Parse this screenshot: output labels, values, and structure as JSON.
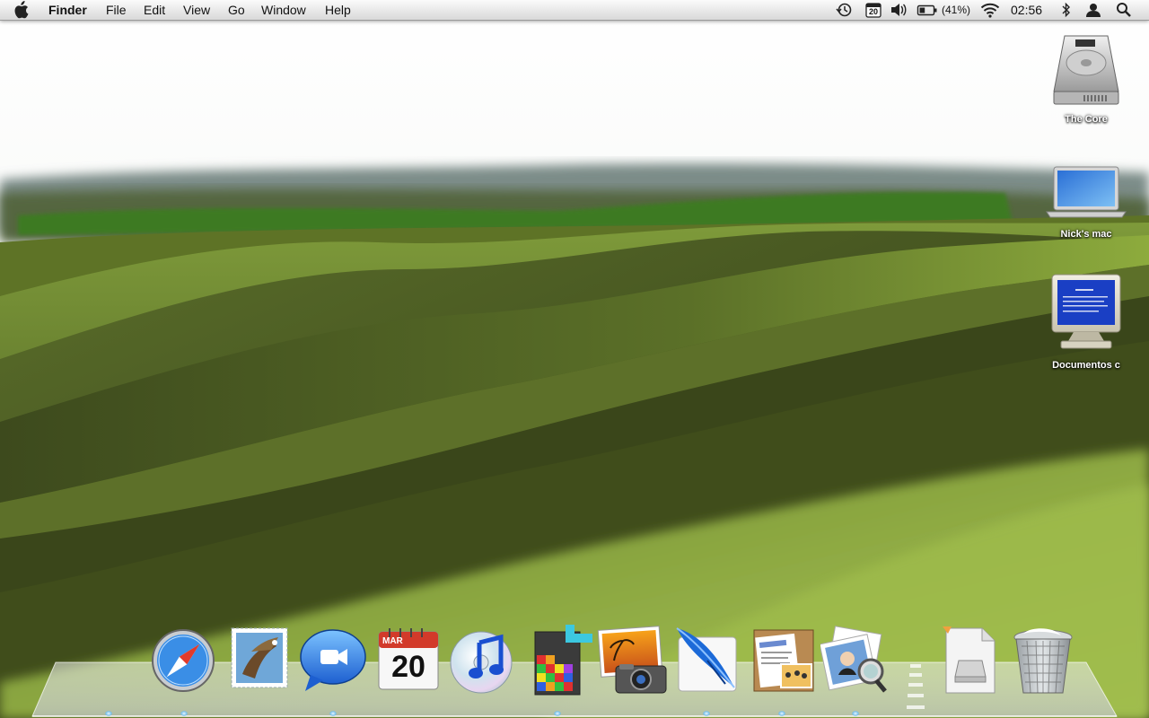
{
  "menubar": {
    "app_name": "Finder",
    "menus": [
      "File",
      "Edit",
      "View",
      "Go",
      "Window",
      "Help"
    ],
    "tray": {
      "calendar_day": "20",
      "battery_percent": "(41%)",
      "time": "02:56",
      "icons": [
        "time-machine-icon",
        "ical-icon",
        "volume-icon",
        "battery-icon",
        "wifi-icon",
        "bluetooth-icon",
        "user-icon",
        "spotlight-icon"
      ]
    }
  },
  "desktop": {
    "icons": [
      {
        "label": "The Core",
        "icon": "hard-drive-icon"
      },
      {
        "label": "Nick's mac",
        "icon": "macbook-icon"
      },
      {
        "label": "Documentos c",
        "icon": "pc-monitor-icon"
      }
    ]
  },
  "dock": {
    "apps": [
      {
        "name": "safari",
        "running": true
      },
      {
        "name": "mail",
        "running": true
      },
      {
        "name": "ichat",
        "running": false
      },
      {
        "name": "ical",
        "running": true,
        "month": "MAR",
        "day": "20"
      },
      {
        "name": "itunes",
        "running": false
      },
      {
        "name": "tetris",
        "running": true
      },
      {
        "name": "iphoto",
        "running": false
      },
      {
        "name": "photoshop",
        "running": true
      },
      {
        "name": "pages",
        "running": true
      },
      {
        "name": "preview",
        "running": true
      }
    ],
    "others": [
      {
        "name": "hard-drive-document"
      },
      {
        "name": "trash"
      }
    ]
  },
  "colors": {
    "sky": "#ffffff",
    "hills_dark": "#3e4a1e",
    "hills_light": "#8fae3a",
    "accent_blue": "#3a7fd8"
  }
}
